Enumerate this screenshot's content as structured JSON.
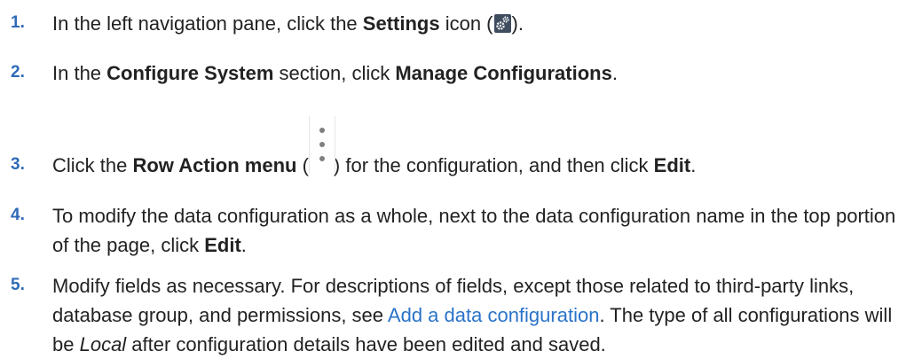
{
  "steps": [
    {
      "number": "1.",
      "t1": "In the left navigation pane, click the ",
      "b1": "Settings",
      "t2": " icon (",
      "icon": "settings-gear-icon",
      "t3": ")."
    },
    {
      "number": "2.",
      "t1": "In the ",
      "b1": "Configure System",
      "t2": " section, click ",
      "b2": "Manage Configurations",
      "t3": "."
    },
    {
      "number": "3.",
      "t1": "Click the ",
      "b1": "Row Action menu",
      "t2": " (",
      "icon": "vertical-ellipsis-icon",
      "t3": ") for the configuration, and then click ",
      "b2": "Edit",
      "t4": "."
    },
    {
      "number": "4.",
      "t1": "To modify the data configuration as a whole, next to the data configuration name in the top portion of the page, click ",
      "b1": "Edit",
      "t2": "."
    },
    {
      "number": "5.",
      "t1": "Modify fields as necessary. For descriptions of fields, except those related to third-party links, database group, and permissions, see ",
      "link": "Add a data configuration",
      "t2": ". The type of all configurations will be ",
      "i1": "Local",
      "t3": " after configuration details have been edited and saved."
    }
  ],
  "colors": {
    "step_number": "#2e6ab7",
    "link": "#2a73c9",
    "text": "#222222",
    "settings_icon_bg": "#3f4d5f",
    "ellipsis_dots": "#7f7f7f"
  }
}
